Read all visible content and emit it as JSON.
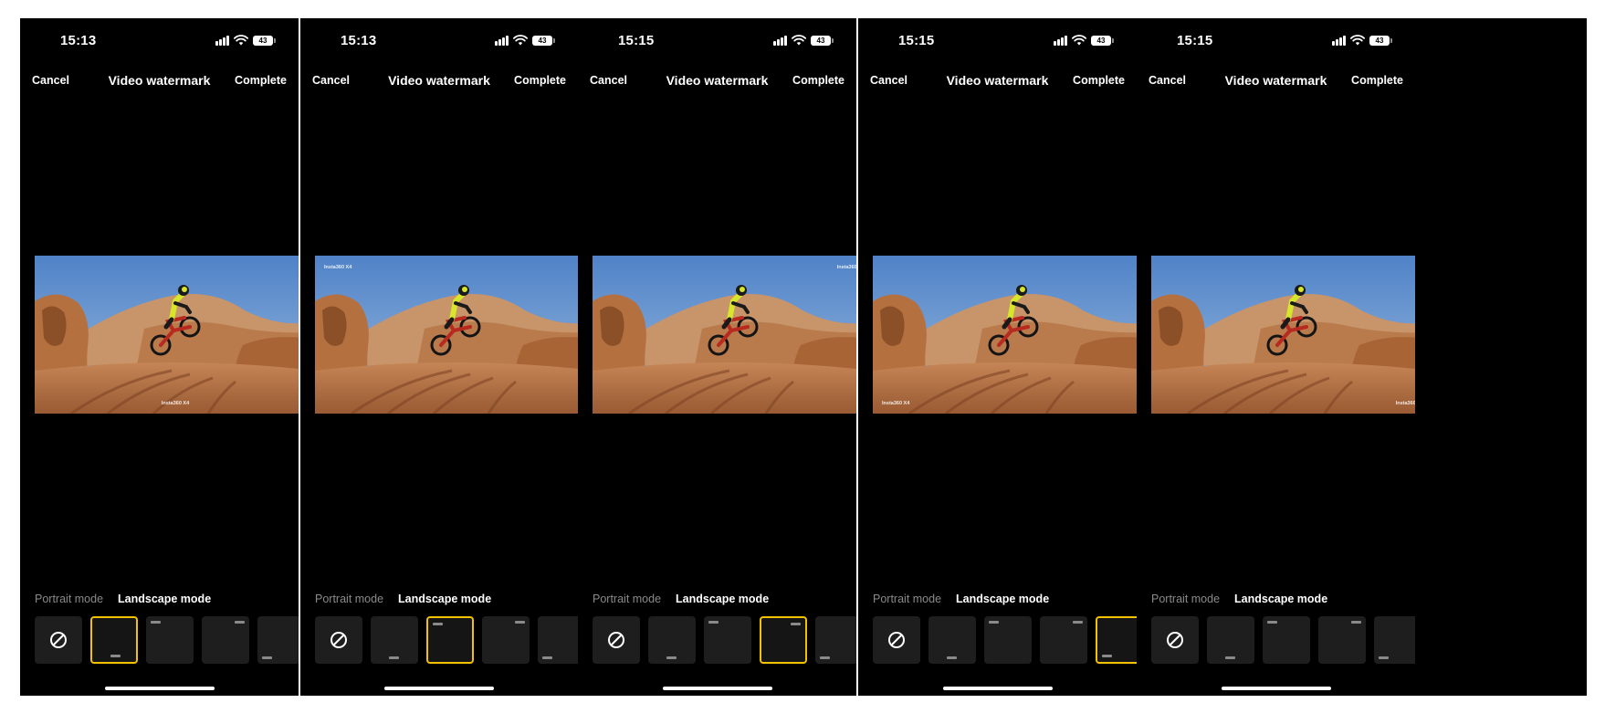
{
  "shared": {
    "cancel_label": "Cancel",
    "title": "Video watermark",
    "complete_label": "Complete",
    "mode_tabs": {
      "portrait": "Portrait mode",
      "landscape": "Landscape mode"
    },
    "active_mode": "Landscape mode",
    "watermark_text": "Insta360 X4",
    "icons": {
      "signal": "signal-bars-icon",
      "wifi": "wifi-icon",
      "battery": "battery-icon",
      "no_watermark": "no-watermark-icon"
    },
    "colors": {
      "selection": "#f2c100",
      "background": "#000000",
      "tile": "#1e1e1e"
    },
    "thumbnail_options": [
      "none",
      "bottom-center",
      "top-left",
      "top-right",
      "bottom-left",
      "bottom-right"
    ]
  },
  "screens": [
    {
      "time": "15:13",
      "battery": "43",
      "watermark_position": "bottom-center",
      "selected_thumbnail": "bottom-center"
    },
    {
      "time": "15:13",
      "battery": "43",
      "watermark_position": "top-left",
      "selected_thumbnail": "top-left"
    },
    {
      "time": "15:15",
      "battery": "43",
      "watermark_position": "top-right",
      "selected_thumbnail": "top-right"
    },
    {
      "time": "15:15",
      "battery": "43",
      "watermark_position": "bottom-left",
      "selected_thumbnail": "bottom-left"
    },
    {
      "time": "15:15",
      "battery": "43",
      "watermark_position": "bottom-right",
      "selected_thumbnail": "bottom-right"
    }
  ]
}
